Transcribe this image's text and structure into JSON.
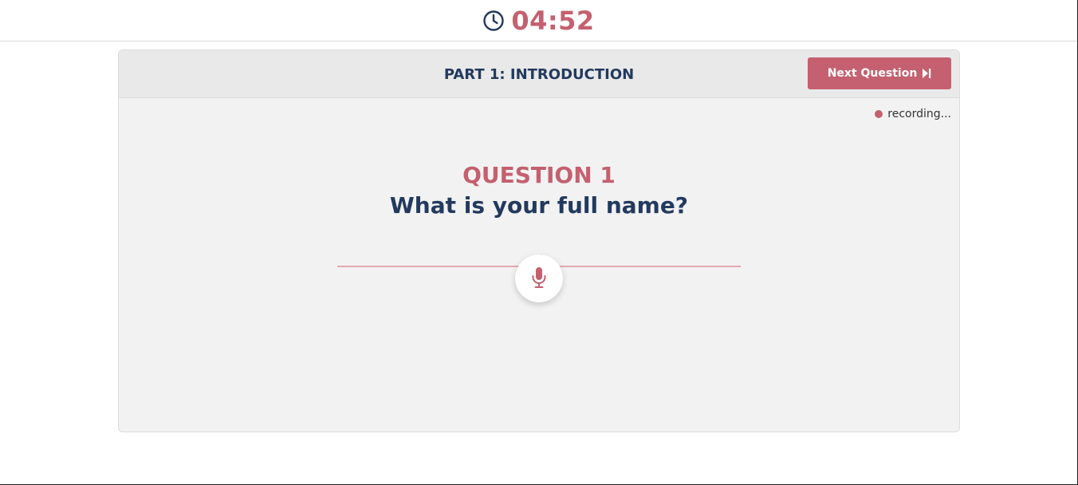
{
  "timer": {
    "icon": "clock-icon",
    "remaining": "04:52"
  },
  "section": {
    "title": "PART 1: INTRODUCTION"
  },
  "actions": {
    "next_label": "Next Question",
    "next_icon": "skip-next-icon"
  },
  "status": {
    "recording_label": "recording..."
  },
  "question": {
    "label": "QUESTION 1",
    "text": "What is your full name?"
  },
  "mic": {
    "icon": "microphone-icon"
  },
  "colors": {
    "accent": "#c4606f",
    "navy": "#233a5e",
    "card_bg": "#f2f2f2",
    "header_bg": "#e9e9e9"
  }
}
